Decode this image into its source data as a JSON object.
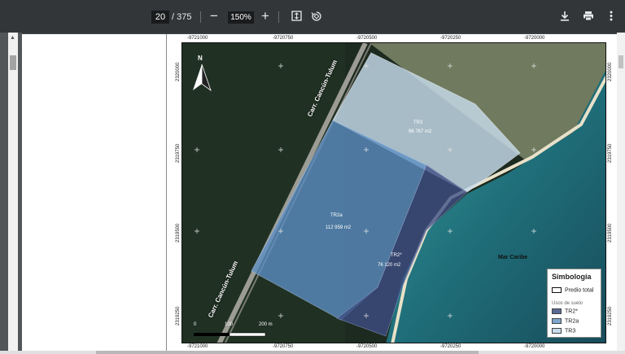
{
  "toolbar": {
    "current_page": "20",
    "total_pages": "/ 375",
    "zoom_out": "−",
    "zoom_level": "150%",
    "zoom_in": "+",
    "fit_icon": "fit-page-icon",
    "rotate_icon": "rotate-icon",
    "download_icon": "download-icon",
    "print_icon": "print-icon",
    "more_icon": "more-vert-icon"
  },
  "map": {
    "x_ticks_top": [
      "-9721000",
      "-9720750",
      "-9720500",
      "-9720250",
      "-9720000"
    ],
    "x_ticks_bottom": [
      "-9721000",
      "-9720750",
      "-9720500",
      "-9720250",
      "-9720000"
    ],
    "y_ticks_left": [
      "2320000",
      "2319750",
      "2319500",
      "2319250"
    ],
    "y_ticks_right": [
      "2320000",
      "2319750",
      "2319500",
      "2319250"
    ],
    "north": "N",
    "road_label_1": "Carr. Cancún-Tulum",
    "road_label_2": "Carr. Cancún-Tulum",
    "sea_label": "Mar Caribe",
    "scale_labels": [
      "0",
      "100",
      "200 m"
    ],
    "zones": [
      {
        "name": "TR3",
        "area": "96 767 m2",
        "color": "#bcd7e8"
      },
      {
        "name": "TR2a",
        "area": "112 959 m2",
        "color": "#4d86c2"
      },
      {
        "name": "TR2*",
        "area": "76 120 m2",
        "color": "#3a4f85"
      }
    ]
  },
  "legend": {
    "title": "Simbología",
    "predio": "Predio total",
    "subtitle": "Usos de suelo",
    "items": [
      {
        "label": "TR2*",
        "color": "#5a6a95"
      },
      {
        "label": "TR2a",
        "color": "#7fa6cc"
      },
      {
        "label": "TR3",
        "color": "#c8dcec"
      }
    ]
  }
}
